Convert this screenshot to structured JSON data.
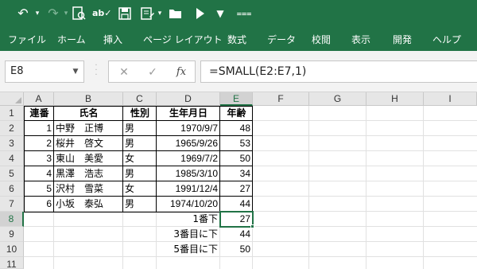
{
  "toolbar": {
    "icons": [
      "undo-icon",
      "redo-icon",
      "print-preview-icon",
      "spelling-icon",
      "save-icon",
      "form-icon",
      "open-folder-icon",
      "run-icon",
      "customize-icon",
      "more-icon"
    ]
  },
  "menu": [
    "ファイル",
    "ホーム",
    "挿入",
    "ページ レイアウト",
    "数式",
    "データ",
    "校閲",
    "表示",
    "開発",
    "ヘルプ"
  ],
  "name_box": "E8",
  "formula_bar": {
    "cancel": "✕",
    "enter": "✓",
    "fx": "fx",
    "formula": "=SMALL(E2:E7,1)"
  },
  "columns": [
    "A",
    "B",
    "C",
    "D",
    "E",
    "F",
    "G",
    "H",
    "I"
  ],
  "rows": [
    "1",
    "2",
    "3",
    "4",
    "5",
    "6",
    "7",
    "8",
    "9",
    "10",
    "11"
  ],
  "table": {
    "headers": [
      "連番",
      "氏名",
      "性別",
      "生年月日",
      "年齢"
    ],
    "records": [
      [
        "1",
        "中野　正博",
        "男",
        "1970/9/7",
        "48"
      ],
      [
        "2",
        "桜井　啓文",
        "男",
        "1965/9/26",
        "53"
      ],
      [
        "3",
        "東山　美愛",
        "女",
        "1969/7/2",
        "50"
      ],
      [
        "4",
        "黒澤　浩志",
        "男",
        "1985/3/10",
        "34"
      ],
      [
        "5",
        "沢村　雪菜",
        "女",
        "1991/12/4",
        "27"
      ],
      [
        "6",
        "小坂　泰弘",
        "男",
        "1974/10/20",
        "44"
      ]
    ]
  },
  "results": [
    {
      "label": "1番下",
      "value": "27"
    },
    {
      "label": "3番目に下",
      "value": "44"
    },
    {
      "label": "5番目に下",
      "value": "50"
    }
  ],
  "colors": {
    "accent": "#217346"
  }
}
